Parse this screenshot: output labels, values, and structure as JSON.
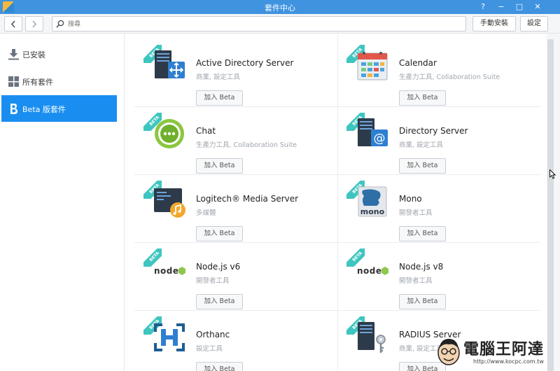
{
  "window": {
    "title": "套件中心",
    "help_icon": "?",
    "minimize_icon": "−",
    "maximize_icon": "□",
    "close_icon": "✕"
  },
  "toolbar": {
    "search_placeholder": "搜尋",
    "manual_install_label": "手動安裝",
    "settings_label": "設定"
  },
  "sidebar": {
    "items": [
      {
        "label": "已安裝",
        "icon": "download-icon",
        "active": false
      },
      {
        "label": "所有套件",
        "icon": "grid-icon",
        "active": false
      },
      {
        "label": "Beta 版套件",
        "icon": "beta-icon",
        "active": true
      }
    ]
  },
  "packages": [
    {
      "name": "Active Directory Server",
      "category": "商業, 設定工具",
      "button": "加入 Beta",
      "badge": "BETA",
      "icon": "active-directory-icon"
    },
    {
      "name": "Calendar",
      "category": "生產力工具, Collaboration Suite",
      "button": "加入 Beta",
      "badge": "BETA",
      "icon": "calendar-icon"
    },
    {
      "name": "Chat",
      "category": "生產力工具, Collaboration Suite",
      "button": "加入 Beta",
      "badge": "BETA",
      "icon": "chat-icon"
    },
    {
      "name": "Directory Server",
      "category": "商業, 設定工具",
      "button": "加入 Beta",
      "badge": "BETA",
      "icon": "directory-server-icon"
    },
    {
      "name": "Logitech® Media Server",
      "category": "多媒體",
      "button": "加入 Beta",
      "badge": "BETA",
      "icon": "media-server-icon"
    },
    {
      "name": "Mono",
      "category": "開發者工具",
      "button": "加入 Beta",
      "badge": "BETA",
      "icon": "mono-icon"
    },
    {
      "name": "Node.js v6",
      "category": "開發者工具",
      "button": "加入 Beta",
      "badge": "BETA",
      "icon": "nodejs-icon"
    },
    {
      "name": "Node.js v8",
      "category": "開發者工具",
      "button": "加入 Beta",
      "badge": "BETA",
      "icon": "nodejs-icon"
    },
    {
      "name": "Orthanc",
      "category": "設定工具",
      "button": "加入 Beta",
      "badge": "BETA",
      "icon": "orthanc-icon"
    },
    {
      "name": "RADIUS Server",
      "category": "商業, 設定工具",
      "button": "加入 Beta",
      "badge": "BETA",
      "icon": "radius-server-icon"
    }
  ],
  "icon_labels": {
    "mono": "mono",
    "node": "node"
  },
  "watermark": {
    "text": "電腦王阿達",
    "url": "http://www.kocpc.com.tw"
  },
  "colors": {
    "titlebar": "#3f93df",
    "active_nav": "#1a8ef0",
    "beta_ribbon": "#3fc5c0"
  }
}
